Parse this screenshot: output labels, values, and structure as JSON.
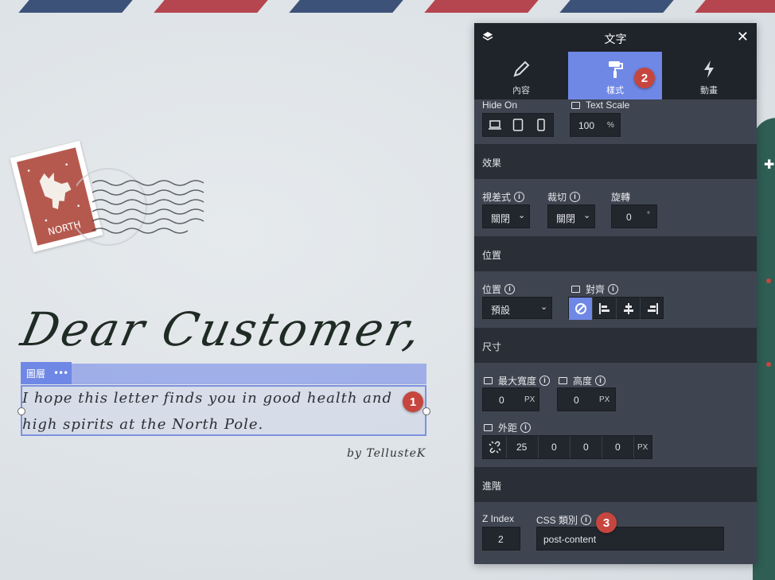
{
  "letter": {
    "heading": "Dear Customer,",
    "body_line1": "I hope this letter finds you in good health and",
    "body_line2": "high spirits at the North Pole.",
    "signature": "by TellusteK",
    "stamp_text": "NORTH"
  },
  "selection": {
    "layer_label": "圖層",
    "more_label": "•••"
  },
  "badges": {
    "b1": "1",
    "b2": "2",
    "b3": "3"
  },
  "panel": {
    "title": "文字",
    "close": "✕",
    "tabs": [
      {
        "label": "內容",
        "icon": "pencil-icon"
      },
      {
        "label": "樣式",
        "icon": "paint-roller-icon"
      },
      {
        "label": "動畫",
        "icon": "lightning-icon"
      }
    ],
    "hide_on": {
      "label": "Hide On"
    },
    "text_scale": {
      "label": "Text Scale",
      "value": "100",
      "unit": "%"
    },
    "effects": {
      "header": "效果",
      "parallax": {
        "label": "視差式",
        "value": "關閉"
      },
      "clip": {
        "label": "裁切",
        "value": "關閉"
      },
      "rotate": {
        "label": "旋轉",
        "value": "0",
        "unit": "°"
      }
    },
    "position": {
      "header": "位置",
      "position": {
        "label": "位置",
        "value": "預設"
      },
      "align": {
        "label": "對齊"
      }
    },
    "size": {
      "header": "尺寸",
      "max_width": {
        "label": "最大寬度",
        "value": "0",
        "unit": "PX"
      },
      "height": {
        "label": "高度",
        "value": "0",
        "unit": "PX"
      },
      "margin": {
        "label": "外距",
        "values": [
          "25",
          "0",
          "0",
          "0"
        ],
        "unit": "PX"
      }
    },
    "advanced": {
      "header": "進階",
      "z_index": {
        "label": "Z Index",
        "value": "2"
      },
      "css_class": {
        "label": "CSS 類別",
        "value": "post-content"
      }
    }
  },
  "colors": {
    "accent": "#6f88e6",
    "badge": "#c6463f",
    "panel": "#3f4550",
    "panel_dark": "#1f232a"
  }
}
